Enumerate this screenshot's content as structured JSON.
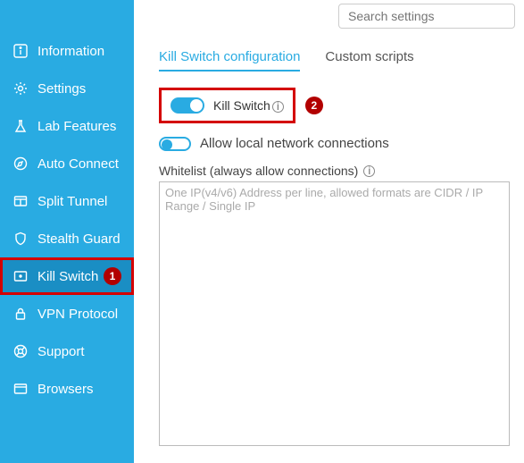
{
  "search": {
    "placeholder": "Search settings"
  },
  "sidebar": {
    "items": [
      {
        "label": "Information"
      },
      {
        "label": "Settings"
      },
      {
        "label": "Lab Features"
      },
      {
        "label": "Auto Connect"
      },
      {
        "label": "Split Tunnel"
      },
      {
        "label": "Stealth Guard"
      },
      {
        "label": "Kill Switch"
      },
      {
        "label": "VPN Protocol"
      },
      {
        "label": "Support"
      },
      {
        "label": "Browsers"
      }
    ]
  },
  "tabs": {
    "config": "Kill Switch configuration",
    "scripts": "Custom scripts"
  },
  "toggles": {
    "killswitch_label": "Kill Switch",
    "allow_local_label": "Allow local network connections"
  },
  "whitelist": {
    "label": "Whitelist (always allow connections)",
    "placeholder": "One IP(v4/v6) Address per line, allowed formats are CIDR / IP Range / Single IP"
  },
  "annotations": {
    "badge1": "1",
    "badge2": "2"
  }
}
